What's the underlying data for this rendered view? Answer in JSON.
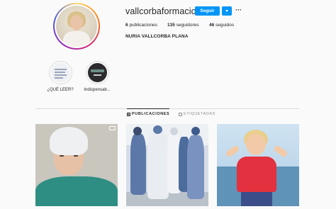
{
  "profile": {
    "username": "vallcorbaformacion",
    "follow_label": "Seguir",
    "more_label": "···",
    "full_name": "NURIA VALLCORBA PLANA"
  },
  "stats": {
    "posts_count": "6",
    "posts_label": "publicaciones",
    "followers_count": "135",
    "followers_label": "seguidores",
    "following_count": "46",
    "following_label": "seguidos"
  },
  "highlights": [
    {
      "label": "¿QUÉ LEER?"
    },
    {
      "label": "Indispensab..."
    }
  ],
  "tabs": [
    {
      "label": "PUBLICACIONES",
      "icon": "grid-icon",
      "active": true
    },
    {
      "label": "ETIQUETADAS",
      "icon": "tag-icon",
      "active": false
    }
  ],
  "posts": [
    {
      "type": "video"
    },
    {
      "type": "image"
    },
    {
      "type": "image"
    }
  ],
  "colors": {
    "accent": "#0095f6",
    "background": "#fafafa",
    "text": "#262626",
    "muted": "#8e8e8e",
    "divider": "#dbdbdb"
  }
}
